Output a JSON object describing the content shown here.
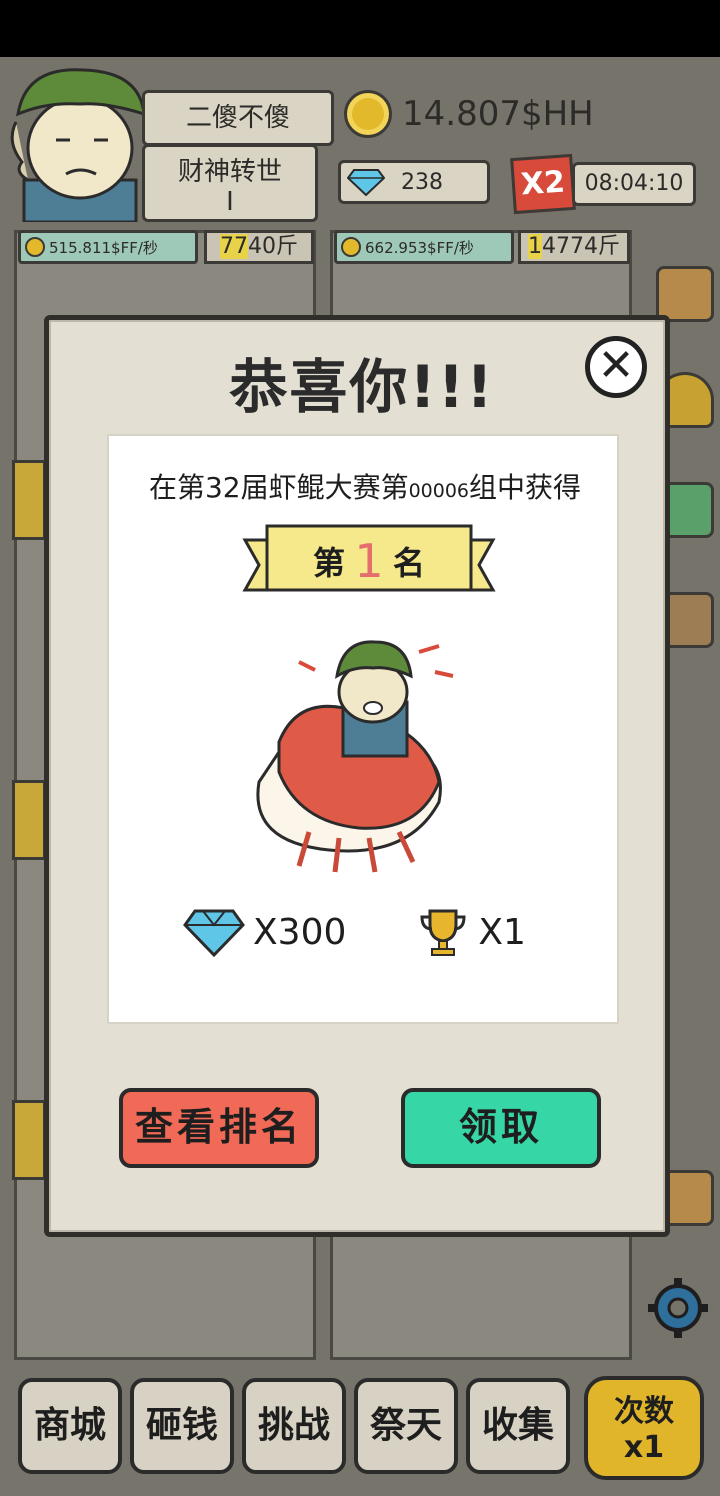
{
  "player": {
    "name": "二傻不傻",
    "title": "财神转世",
    "title_level": "I"
  },
  "currency": {
    "coins": "14.807$HH",
    "gems": "238",
    "boost": "X2",
    "timer": "08:04:10"
  },
  "cards": [
    {
      "rate": "515.811$FF/秒",
      "weight_hl": "77",
      "weight_rest": "40斤"
    },
    {
      "rate": "662.953$FF/秒",
      "weight_hl": "1",
      "weight_rest": "4774斤"
    }
  ],
  "modal": {
    "title": "恭喜你!!!",
    "result_prefix": "在第32届虾鲲大赛第",
    "group_no": "00006",
    "result_suffix": "组中获得",
    "rank_prefix": "第",
    "rank_number": "1",
    "rank_suffix": "名",
    "reward_gems": "X300",
    "reward_trophies": "X1",
    "view_rank_label": "查看排名",
    "claim_label": "领取"
  },
  "nav": {
    "shop": "商城",
    "smash": "砸钱",
    "challenge": "挑战",
    "worship": "祭天",
    "collect": "收集",
    "times_label": "次数",
    "times_value": "x1"
  },
  "colors": {
    "view_rank_button": "#f06a57",
    "claim_button": "#37d6a6",
    "rank_number": "#e46d6d",
    "ribbon": "#f5e98c"
  }
}
